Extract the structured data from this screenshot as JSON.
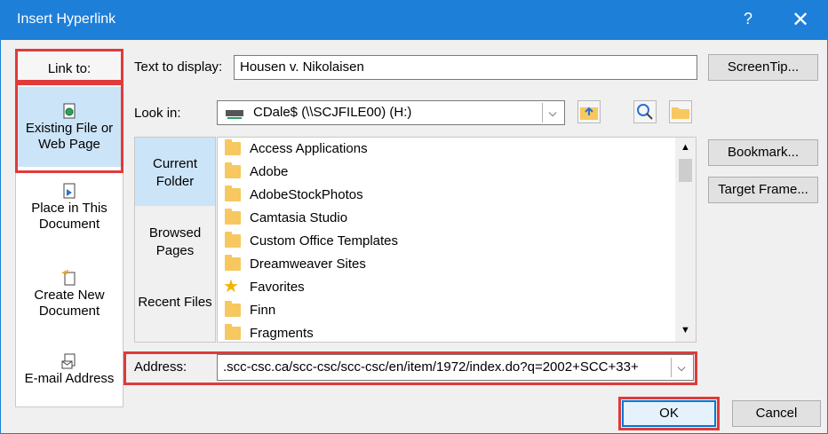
{
  "titlebar": {
    "title": "Insert Hyperlink",
    "help": "?",
    "close": "✕"
  },
  "link_to": {
    "header": "Link to:",
    "options": [
      {
        "label": "Existing File or Web Page",
        "icon": "existing-file-icon",
        "selected": true
      },
      {
        "label": "Place in This Document",
        "icon": "place-in-document-icon"
      },
      {
        "label": "Create New Document",
        "icon": "create-new-document-icon"
      },
      {
        "label": "E-mail Address",
        "icon": "email-address-icon"
      }
    ]
  },
  "text_to_display": {
    "label": "Text to display:",
    "value": "Housen v. Nikolaisen"
  },
  "screentip_label": "ScreenTip...",
  "look_in": {
    "label": "Look in:",
    "value": "CDale$ (\\\\SCJFILE00) (H:)"
  },
  "sidebar": {
    "items": [
      "Current Folder",
      "Browsed Pages",
      "Recent Files"
    ]
  },
  "files": [
    "Access Applications",
    "Adobe",
    "AdobeStockPhotos",
    "Camtasia Studio",
    "Custom Office Templates",
    "Dreamweaver Sites",
    "Favorites",
    "Finn",
    "Fragments"
  ],
  "bookmark_label": "Bookmark...",
  "target_frame_label": "Target Frame...",
  "address": {
    "label": "Address:",
    "value": ".scc-csc.ca/scc-csc/scc-csc/en/item/1972/index.do?q=2002+SCC+33+"
  },
  "ok_label": "OK",
  "cancel_label": "Cancel",
  "colors": {
    "titlebar": "#1e7fd8",
    "highlight": "#e03a3a",
    "selection": "#cce4f7"
  }
}
